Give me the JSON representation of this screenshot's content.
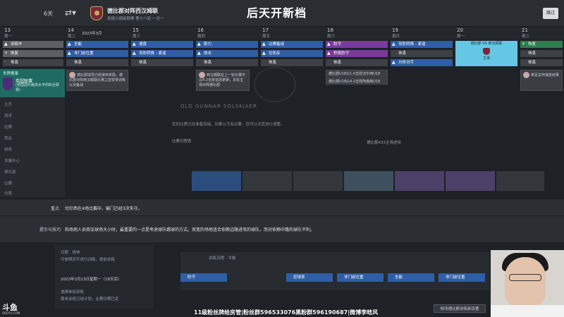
{
  "topbar": {
    "days": "6天",
    "match_title": "德比郡对阵西汉姆联",
    "match_sub": "英格兰超级联赛 第十八轮 一对一",
    "title": "后天开新档",
    "skip_label": "跳过"
  },
  "calendar": {
    "month_label": "2023年3月",
    "days": [
      {
        "num": "13",
        "wd": "周一"
      },
      {
        "num": "14",
        "wd": "周二"
      },
      {
        "num": "15",
        "wd": "周三"
      },
      {
        "num": "16",
        "wd": "周四"
      },
      {
        "num": "17",
        "wd": "周五"
      },
      {
        "num": "18",
        "wd": "周六"
      },
      {
        "num": "19",
        "wd": "周日"
      },
      {
        "num": "20",
        "wd": "周一"
      },
      {
        "num": "21",
        "wd": "周二"
      }
    ]
  },
  "schedule": {
    "d13": [
      "训练中",
      "恢复",
      "休息"
    ],
    "d14": [
      "全能",
      "非门前位置",
      "休息"
    ],
    "d15": [
      "速度",
      "攻防转换 - 紧逼",
      "休息"
    ],
    "d16": [
      "耐力",
      "放击",
      "休息"
    ],
    "d17": [
      "比赛备战",
      "拉防反",
      "休息"
    ],
    "d18": [
      "防守",
      "积极防守",
      "休息"
    ],
    "d19": [
      "攻防转换 - 紧逼",
      "休息",
      "分析对手"
    ],
    "d20_match": "德比郡 VS 西汉姆联",
    "d20_sub": "主场",
    "d21": [
      "恢复",
      "休息",
      "休息"
    ]
  },
  "event_cards": {
    "c14": "德比郡球员已经得到奖励，德比郡对阵西汉姆联比赛之前安排训练以及备战",
    "c16": "西汉姆联在上一轮比赛中以4-2击败伯恩茅斯，本轮主场对阵德比郡",
    "c18": "德比郡U18以1-0击败切尔西U18",
    "c18b": "德比郡U18以4-2击败阿森纳U18",
    "c21": "英足总杯抽签结果"
  },
  "leftnav": {
    "tab_label": "世界赛事",
    "league_name": "英超联赛",
    "league_desc": "(英国国内最高水平的职业联赛)",
    "items": [
      "主页",
      "战术",
      "比赛",
      "转会",
      "财务",
      "发展中心",
      "俱乐部",
      "比赛",
      "交易"
    ]
  },
  "modal": {
    "title": "OLD GUNNAR SOLSKJAER",
    "line1": "您的比赛已经准备就绪，如果认为有必要，您可以对其进行调整。",
    "tab_label": "比赛日程表",
    "right_label": "德比郡433主场进攻"
  },
  "info": {
    "k1": "重点",
    "v1": "切尔西在4场比赛中，输门已经3次失守。",
    "k2": "提示与技巧",
    "v2": "和场地人员商议球场大小时，最重要的一点是考虑球队踢球的方式。双宽的场地适合依赖边路进攻的球队，而对依赖中路的球队不利。"
  },
  "bottom": {
    "left_lines": [
      "日程 · 场地",
      "可参照对手进行训练，提前训练",
      "2023年3月13日星期一（18天后）",
      "选择参加训练",
      "周末训练已经计划，比赛日期已定"
    ],
    "table_head": "训练日程 - 平衡",
    "table_cells": [
      "防守",
      "控球率",
      "非门前位置",
      "全能",
      "非门前位置"
    ],
    "advance_btn": "修改德比郡训练新设置"
  },
  "overlay": {
    "subtitle": "11级粉丝牌给房管|粉丝群596533076黑粉群596190687|微博李晗风",
    "brand": "斗鱼",
    "brand_sub": "DOUYU.COM"
  },
  "colors": {
    "accent_blue": "#2f5ea6",
    "accent_purple": "#7a3a9c",
    "match_cyan": "#66c7e4",
    "nav_teal": "#1f6b63"
  }
}
